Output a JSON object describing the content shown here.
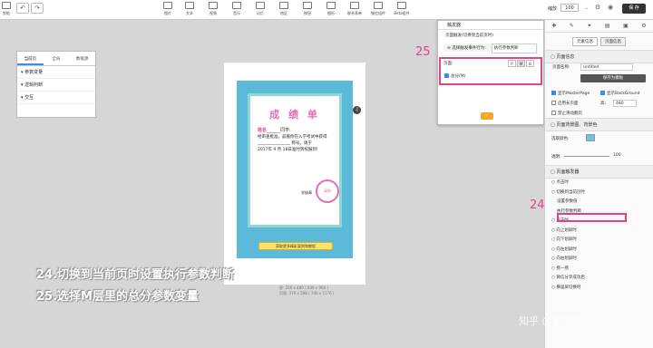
{
  "toolbar": {
    "left_label": "剪贴",
    "items": [
      "图片",
      "文本",
      "视频",
      "音乐",
      "幻灯",
      "热区",
      "按钮",
      "图形",
      "联系表单",
      "微信组件",
      "Beta组件"
    ],
    "zoom_label": "缩放",
    "zoom_value": "100",
    "save_label": "保 存"
  },
  "left_panel": {
    "tabs": [
      "当前页",
      "全局",
      "数据源"
    ],
    "sections": [
      "参数变量",
      "逻辑判断",
      "交互"
    ]
  },
  "certificate": {
    "title": "成 绩 单",
    "name_label": "姓名",
    "name_suffix": "同学:",
    "body_line1": "经审查批准，兹嘉你在入学考试中获得",
    "body_line2": "称号。请于",
    "body_line3": "2017年 9 月 18日准时到校报到!",
    "stamp_text": "录取",
    "signature": "学校章",
    "button_label": "获取更多精彩案例和教程",
    "music_icon": "♫"
  },
  "canvas_dims": {
    "line1": "屏: 320 x 480 ( 640 x 960 )",
    "line2": "页面: 370 x 588 ( 740 x 1176 )"
  },
  "dialog": {
    "title": "触发器",
    "subtitle": "页面触发(切换到当前页时)",
    "action_label": "选择触发事件行为:",
    "action_value": "执行参数判断",
    "page_label": "页面:",
    "page_buttons": [
      "P",
      "M",
      "B"
    ],
    "checkbox_label": "总分(M)"
  },
  "right_panel": {
    "tabs": [
      "元素信息",
      "页面信息"
    ],
    "section_page": "页面信息",
    "page_name_label": "页面名称:",
    "page_name_value": "untitled",
    "save_template": "保存为模板",
    "opt_master": "显示MasterPage",
    "opt_background": "显示BackGround",
    "opt_long": "启用长页面",
    "opt_height_label": "高:",
    "opt_height_value": "480",
    "opt_disable_scroll": "禁止滑动翻页",
    "section_bg": "页面背景图、背景色",
    "bg_color_label": "选取颜色:",
    "opacity_label": "透明:",
    "opacity_value": "100",
    "section_trigger": "页面触发器",
    "trigger_items": [
      "点击时",
      "切换到当前页时",
      "设置参数值",
      "执行参数判断",
      "双击时",
      "向上划屏时",
      "向下划屏时",
      "向左划屏时",
      "向右划屏时",
      "摇一摇",
      "微信分享成功后",
      "横竖屏切换时"
    ]
  },
  "annotations": {
    "num25": "25",
    "num24": "24",
    "caption1": "24.切换到当前页时设置执行参数判断",
    "caption2": "25.选择M层里的总分参数变量",
    "watermark": "知乎 @言之慎"
  }
}
